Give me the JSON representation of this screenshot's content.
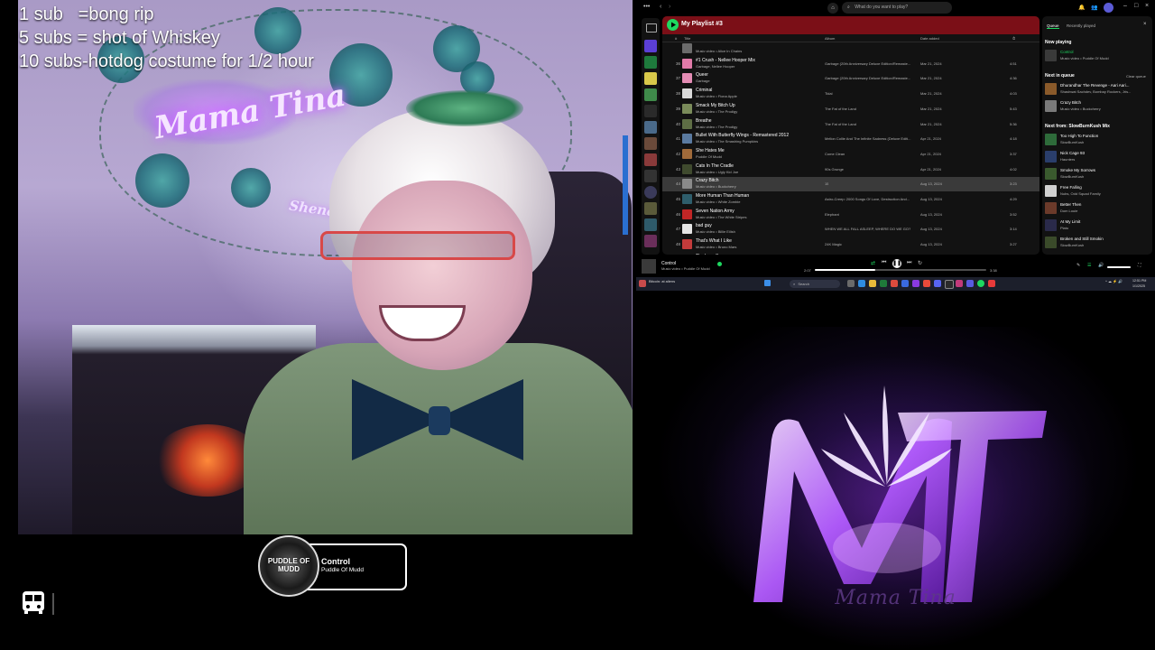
{
  "stream": {
    "sub_goals": [
      "1 sub   =bong rip",
      "5 subs = shot of Whiskey",
      "10 subs-hotdog costume for 1/2 hour"
    ],
    "neon_sign": "Mama Tina",
    "neon_sign_small": "Shenanigans"
  },
  "now_playing_widget": {
    "album_label": "PUDDLE OF MUDD",
    "title": "Control",
    "artist": "Puddle Of Mudd"
  },
  "spotify": {
    "search_placeholder": "What do you want to play?",
    "playlist_title": "My Playlist #3",
    "columns": {
      "num": "#",
      "title": "Title",
      "album": "Album",
      "date": "Date added",
      "duration": "⏱"
    },
    "rows": [
      {
        "num": "",
        "title": "",
        "artist": "Music video • Alice In Chains",
        "album": "",
        "date": "",
        "duration": "",
        "color": "#6b6b6b"
      },
      {
        "num": "36",
        "title": "#1 Crush - Nellee Hooper Mix",
        "artist": "Garbage, Nellee Hooper",
        "album": "Garbage (20th Anniversary Deluxe Edition/Remaste...",
        "date": "Mar 21, 2024",
        "duration": "4:51",
        "color": "#e07aa8"
      },
      {
        "num": "37",
        "title": "Queer",
        "artist": "Garbage",
        "album": "Garbage (20th Anniversary Deluxe Edition/Remaste...",
        "date": "Mar 21, 2024",
        "duration": "4:36",
        "color": "#e48cb4"
      },
      {
        "num": "38",
        "title": "Criminal",
        "artist": "Music video • Fiona Apple",
        "album": "Tidal",
        "date": "Mar 21, 2024",
        "duration": "4:03",
        "color": "#d9d9d9"
      },
      {
        "num": "39",
        "title": "Smack My Bitch Up",
        "artist": "Music video • The Prodigy",
        "album": "The Fat of the Land",
        "date": "Mar 21, 2024",
        "duration": "5:43",
        "color": "#7a8b5a"
      },
      {
        "num": "40",
        "title": "Breathe",
        "artist": "Music video • The Prodigy",
        "album": "The Fat of the Land",
        "date": "Mar 21, 2024",
        "duration": "5:36",
        "color": "#5e6e45"
      },
      {
        "num": "41",
        "title": "Bullet With Butterfly Wings - Remastered 2012",
        "artist": "Music video • The Smashing Pumpkins",
        "album": "Mellon Collie And The Infinite Sadness (Deluxe Editi...",
        "date": "Apr 21, 2024",
        "duration": "4:18",
        "color": "#5a7aa0"
      },
      {
        "num": "42",
        "title": "She Hates Me",
        "artist": "Puddle Of Mudd",
        "album": "Come Clean",
        "date": "Apr 21, 2024",
        "duration": "3:37",
        "color": "#a06a3a"
      },
      {
        "num": "43",
        "title": "Cats In The Cradle",
        "artist": "Music video • Ugly Kid Joe",
        "album": "90s Grunge",
        "date": "Apr 21, 2024",
        "duration": "4:02",
        "color": "#3f4a2e"
      },
      {
        "num": "44",
        "title": "Crazy Bitch",
        "artist": "Music video • Buckcherry",
        "album": "15",
        "date": "Aug 13, 2024",
        "duration": "3:23",
        "color": "#8a8a8a",
        "selected": true
      },
      {
        "num": "45",
        "title": "More Human Than Human",
        "artist": "Music video • White Zombie",
        "album": "Astro-Creep: 2000 Songs Of Love, Destruction And...",
        "date": "Aug 13, 2024",
        "duration": "4:29",
        "color": "#2e5d6b"
      },
      {
        "num": "46",
        "title": "Seven Nation Army",
        "artist": "Music video • The White Stripes",
        "album": "Elephant",
        "date": "Aug 13, 2024",
        "duration": "3:52",
        "color": "#c12626"
      },
      {
        "num": "47",
        "title": "bad guy",
        "artist": "Music video • Billie Eilish",
        "album": "WHEN WE ALL FALL ASLEEP, WHERE DO WE GO?",
        "date": "Aug 13, 2024",
        "duration": "3:14",
        "color": "#e5e5e5"
      },
      {
        "num": "48",
        "title": "That's What I Like",
        "artist": "Music video • Bruno Mars",
        "album": "24K Magic",
        "date": "Aug 13, 2024",
        "duration": "3:27",
        "color": "#c23b3b"
      },
      {
        "num": "49",
        "title": "The Lazy Song",
        "artist": "",
        "album": "",
        "date": "",
        "duration": "",
        "color": "#d4a24a"
      }
    ],
    "queue": {
      "tab_queue": "Queue",
      "tab_recent": "Recently played",
      "now_playing_heading": "Now playing",
      "now_playing": {
        "title": "Control",
        "artist": "Music video • Puddle Of Mudd",
        "color": "#3a3a3a"
      },
      "next_heading": "Next in queue",
      "clear_label": "Clear queue",
      "next": [
        {
          "title": "Dhurandhar The Revenge - Aari Aari...",
          "artist": "Shashwat Sachdev, Bombay Rockers, Jris...",
          "color": "#8a5a2a"
        },
        {
          "title": "Crazy Bitch",
          "artist": "Music video • Buckcherry",
          "color": "#7a7a7a"
        }
      ],
      "from_heading": "Next from: SlowBurnKush Mix",
      "from": [
        {
          "title": "Too High To Function",
          "artist": "SlowBurnKush",
          "color": "#2e6b3a"
        },
        {
          "title": "Nick Cage 93",
          "artist": "Haunters",
          "color": "#2a3e6b"
        },
        {
          "title": "Smoke My Sorrows",
          "artist": "SlowBurnKush",
          "color": "#3a5a2e"
        },
        {
          "title": "Free Falling",
          "artist": "Nubs, Odd Squad Family",
          "color": "#d0d0d0"
        },
        {
          "title": "Better Then",
          "artist": "Dom Louie",
          "color": "#6b3a2a"
        },
        {
          "title": "At My Limit",
          "artist": "Plato",
          "color": "#2a2a4a"
        },
        {
          "title": "Broken and Still Smokin",
          "artist": "SlowBurnKush",
          "color": "#3a4a2a"
        }
      ]
    },
    "player": {
      "title": "Control",
      "artist": "Music video • Puddle Of Mudd",
      "elapsed": "2:07",
      "total": "3:38",
      "progress": 0.35
    }
  },
  "taskbar": {
    "app_label": "Bitcoin: at aliens",
    "search_label": "Search",
    "time": "12:51 PM",
    "date": "1/1/2025"
  },
  "logo": {
    "monogram": "MT",
    "wordmark": "Mama Tina"
  },
  "colors": {
    "spotify_green": "#1ed760",
    "playlist_header": "#7b0f17",
    "logo_purple": "#c77dff"
  }
}
